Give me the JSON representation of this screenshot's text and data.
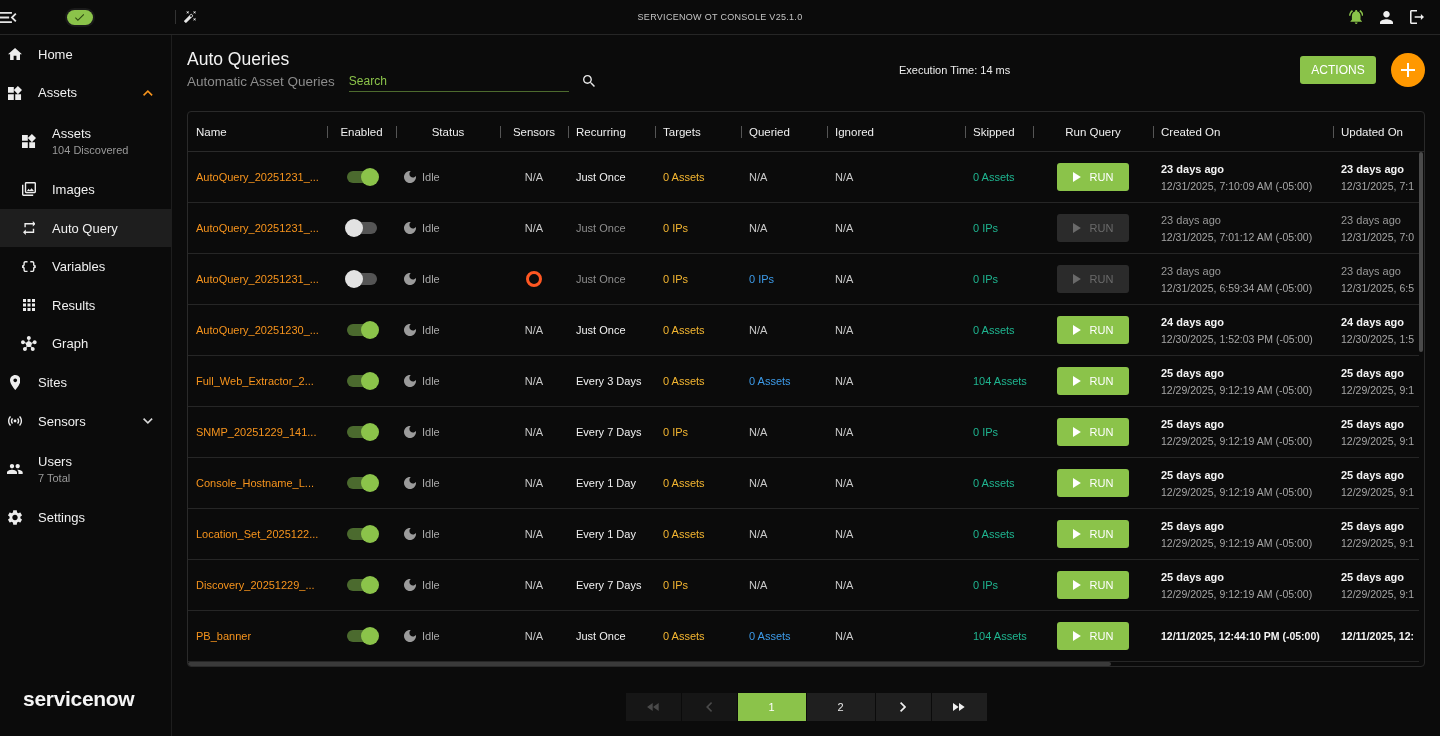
{
  "topbar": {
    "status_toggle": {
      "on": true
    },
    "title": "SERVICENOW OT CONSOLE V25.1.0"
  },
  "sidebar": {
    "items": [
      {
        "kind": "link",
        "label": "Home",
        "selected": false
      },
      {
        "kind": "group",
        "label": "Assets",
        "selected": false,
        "expanded": true,
        "children": [
          {
            "label": "Assets",
            "sublabel": "104 Discovered",
            "selected": false
          },
          {
            "label": "Images",
            "selected": false
          },
          {
            "label": "Auto Query",
            "selected": true
          },
          {
            "label": "Variables",
            "selected": false
          },
          {
            "label": "Results",
            "selected": false
          },
          {
            "label": "Graph",
            "selected": false
          }
        ]
      },
      {
        "kind": "link",
        "label": "Sites",
        "selected": false
      },
      {
        "kind": "group",
        "label": "Sensors",
        "selected": false,
        "expanded": false
      },
      {
        "kind": "link",
        "label": "Users",
        "sublabel": "7 Total",
        "selected": false
      },
      {
        "kind": "link",
        "label": "Settings",
        "selected": false
      }
    ],
    "logo": "servicenow"
  },
  "page": {
    "title": "Auto Queries",
    "subtitle": "Automatic Asset Queries",
    "search": {
      "placeholder": "Search"
    },
    "execution_time": "Execution Time: 14 ms",
    "actions_button": "ACTIONS"
  },
  "table": {
    "columns": [
      "Name",
      "Enabled",
      "Status",
      "Sensors",
      "Recurring",
      "Targets",
      "Queried",
      "Ignored",
      "Skipped",
      "Run Query",
      "Created On",
      "Updated On"
    ],
    "rows": [
      {
        "name": "AutoQuery_20251231_...",
        "enabled": true,
        "status": "Idle",
        "sensors": {
          "kind": "text",
          "text": "N/A"
        },
        "recurring": "Just Once",
        "targets": "0 Assets",
        "queried": {
          "kind": "text",
          "text": "N/A"
        },
        "ignored": "N/A",
        "skipped": "0 Assets",
        "run_label": "RUN",
        "created_on": {
          "relative": "23 days ago",
          "timestamp": "12/31/2025, 7:10:09 AM (-05:00)"
        },
        "updated_on": {
          "relative": "23 days ago",
          "timestamp": "12/31/2025, 7:1"
        }
      },
      {
        "name": "AutoQuery_20251231_...",
        "enabled": false,
        "status": "Idle",
        "sensors": {
          "kind": "text",
          "text": "N/A"
        },
        "recurring": "Just Once",
        "targets": "0 IPs",
        "queried": {
          "kind": "text",
          "text": "N/A"
        },
        "ignored": "N/A",
        "skipped": "0 IPs",
        "run_label": "RUN",
        "created_on": {
          "relative": "23 days ago",
          "timestamp": "12/31/2025, 7:01:12 AM (-05:00)"
        },
        "updated_on": {
          "relative": "23 days ago",
          "timestamp": "12/31/2025, 7:0"
        }
      },
      {
        "name": "AutoQuery_20251231_...",
        "enabled": false,
        "status": "Idle",
        "sensors": {
          "kind": "icon"
        },
        "recurring": "Just Once",
        "targets": "0 IPs",
        "queried": {
          "kind": "link",
          "text": "0 IPs"
        },
        "ignored": "N/A",
        "skipped": "0 IPs",
        "run_label": "RUN",
        "created_on": {
          "relative": "23 days ago",
          "timestamp": "12/31/2025, 6:59:34 AM (-05:00)"
        },
        "updated_on": {
          "relative": "23 days ago",
          "timestamp": "12/31/2025, 6:5"
        }
      },
      {
        "name": "AutoQuery_20251230_...",
        "enabled": true,
        "status": "Idle",
        "sensors": {
          "kind": "text",
          "text": "N/A"
        },
        "recurring": "Just Once",
        "targets": "0 Assets",
        "queried": {
          "kind": "text",
          "text": "N/A"
        },
        "ignored": "N/A",
        "skipped": "0 Assets",
        "run_label": "RUN",
        "created_on": {
          "relative": "24 days ago",
          "timestamp": "12/30/2025, 1:52:03 PM (-05:00)"
        },
        "updated_on": {
          "relative": "24 days ago",
          "timestamp": "12/30/2025, 1:5"
        }
      },
      {
        "name": "Full_Web_Extractor_2...",
        "enabled": true,
        "status": "Idle",
        "sensors": {
          "kind": "text",
          "text": "N/A"
        },
        "recurring": "Every 3 Days",
        "targets": "0 Assets",
        "queried": {
          "kind": "link",
          "text": "0 Assets"
        },
        "ignored": "N/A",
        "skipped": "104 Assets",
        "run_label": "RUN",
        "created_on": {
          "relative": "25 days ago",
          "timestamp": "12/29/2025, 9:12:19 AM (-05:00)"
        },
        "updated_on": {
          "relative": "25 days ago",
          "timestamp": "12/29/2025, 9:1"
        }
      },
      {
        "name": "SNMP_20251229_141...",
        "enabled": true,
        "status": "Idle",
        "sensors": {
          "kind": "text",
          "text": "N/A"
        },
        "recurring": "Every 7 Days",
        "targets": "0 IPs",
        "queried": {
          "kind": "text",
          "text": "N/A"
        },
        "ignored": "N/A",
        "skipped": "0 IPs",
        "run_label": "RUN",
        "created_on": {
          "relative": "25 days ago",
          "timestamp": "12/29/2025, 9:12:19 AM (-05:00)"
        },
        "updated_on": {
          "relative": "25 days ago",
          "timestamp": "12/29/2025, 9:1"
        }
      },
      {
        "name": "Console_Hostname_L...",
        "enabled": true,
        "status": "Idle",
        "sensors": {
          "kind": "text",
          "text": "N/A"
        },
        "recurring": "Every 1 Day",
        "targets": "0 Assets",
        "queried": {
          "kind": "text",
          "text": "N/A"
        },
        "ignored": "N/A",
        "skipped": "0 Assets",
        "run_label": "RUN",
        "created_on": {
          "relative": "25 days ago",
          "timestamp": "12/29/2025, 9:12:19 AM (-05:00)"
        },
        "updated_on": {
          "relative": "25 days ago",
          "timestamp": "12/29/2025, 9:1"
        }
      },
      {
        "name": "Location_Set_2025122...",
        "enabled": true,
        "status": "Idle",
        "sensors": {
          "kind": "text",
          "text": "N/A"
        },
        "recurring": "Every 1 Day",
        "targets": "0 Assets",
        "queried": {
          "kind": "text",
          "text": "N/A"
        },
        "ignored": "N/A",
        "skipped": "0 Assets",
        "run_label": "RUN",
        "created_on": {
          "relative": "25 days ago",
          "timestamp": "12/29/2025, 9:12:19 AM (-05:00)"
        },
        "updated_on": {
          "relative": "25 days ago",
          "timestamp": "12/29/2025, 9:1"
        }
      },
      {
        "name": "Discovery_20251229_...",
        "enabled": true,
        "status": "Idle",
        "sensors": {
          "kind": "text",
          "text": "N/A"
        },
        "recurring": "Every 7 Days",
        "targets": "0 IPs",
        "queried": {
          "kind": "text",
          "text": "N/A"
        },
        "ignored": "N/A",
        "skipped": "0 IPs",
        "run_label": "RUN",
        "created_on": {
          "relative": "25 days ago",
          "timestamp": "12/29/2025, 9:12:19 AM (-05:00)"
        },
        "updated_on": {
          "relative": "25 days ago",
          "timestamp": "12/29/2025, 9:1"
        }
      },
      {
        "name": "PB_banner",
        "enabled": true,
        "status": "Idle",
        "sensors": {
          "kind": "text",
          "text": "N/A"
        },
        "recurring": "Just Once",
        "targets": "0 Assets",
        "queried": {
          "kind": "link",
          "text": "0 Assets"
        },
        "ignored": "N/A",
        "skipped": "104 Assets",
        "run_label": "RUN",
        "created_on": {
          "timestamp": "12/11/2025, 12:44:10 PM (-05:00)"
        },
        "updated_on": {
          "timestamp": "12/11/2025, 12:"
        }
      }
    ]
  },
  "pagination": {
    "controls": [
      {
        "kind": "first",
        "disabled": true
      },
      {
        "kind": "prev",
        "disabled": true
      },
      {
        "kind": "page",
        "label": "1",
        "selected": true
      },
      {
        "kind": "page",
        "label": "2",
        "selected": false
      },
      {
        "kind": "next",
        "disabled": false
      },
      {
        "kind": "last",
        "disabled": false
      }
    ]
  }
}
